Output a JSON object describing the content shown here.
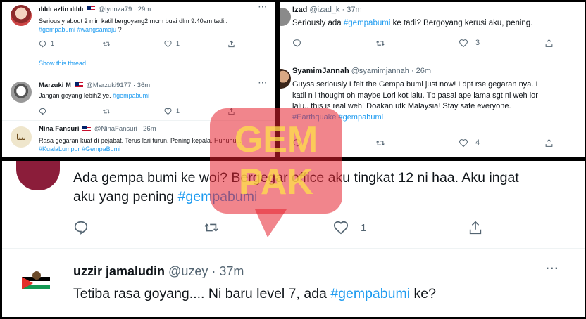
{
  "panel_top_left": {
    "tweets": [
      {
        "name": "ılılılı azlin ılılılı",
        "handle": "@lynnza79",
        "time": "29m",
        "text_plain": "Seriously about 2 min katil bergoyang2 mcm buai dlm 9.40am tadi..",
        "tags": [
          "#gempabumi",
          "#wangsamaju",
          "?"
        ],
        "reply_count": "1",
        "retweet_count": "",
        "like_count": "1",
        "show_thread": "Show this thread"
      },
      {
        "name": "Marzuki M",
        "handle": "@Marzuki9177",
        "time": "36m",
        "text_plain": "Jangan goyang lebih2 ye.",
        "tag": "#gempabumi",
        "reply_count": "",
        "retweet_count": "",
        "like_count": "1"
      },
      {
        "name": "Nina Fansuri",
        "handle": "@NinaFansuri",
        "time": "26m",
        "text_plain": "Rasa gegaran kuat di pejabat. Terus lari turun. Pening kepala. Huhuhu...",
        "tags": [
          "#KualaLumpur",
          "#GempaBumi"
        ]
      }
    ]
  },
  "panel_top_right": {
    "tweets": [
      {
        "name": "Izad",
        "handle": "@izad_k",
        "time": "37m",
        "text_before": "Seriously ada",
        "tag": "#gempabumi",
        "text_after": "ke tadi? Bergoyang kerusi aku, pening.",
        "reply_count": "",
        "retweet_count": "",
        "like_count": "3"
      },
      {
        "name": "SyamimJannah",
        "handle": "@syamimjannah",
        "time": "26m",
        "text_lines": [
          "Guyss seriously I felt the Gempa bumi just now! I dpt rse gegaran nya. I",
          "katil n i thought oh maybe Lori kot lalu. Tp pasal ape lama sgt ni weh lor",
          "lalu.. this is real weh! Doakan utk Malaysia! Stay safe everyone."
        ],
        "tags": [
          "#Earthquake",
          "#gempabumi"
        ],
        "reply_count": "",
        "retweet_count": "",
        "like_count": "4"
      }
    ]
  },
  "panel_bottom": {
    "tweets": [
      {
        "text_line1": "Ada gempa bumi ke woi? Bergegar office aku tingkat 12 ni haa. Aku ingat",
        "text_line2_plain": "aku yang pening",
        "tag": "#gempabumi",
        "reply_count": "",
        "retweet_count": "",
        "like_count": "1"
      },
      {
        "name": "uzzir jamaludin",
        "handle": "@uzey",
        "time": "37m",
        "text_before": "Tetiba rasa goyang.... Ni baru level 7, ada",
        "tag": "#gempabumi",
        "text_after": "ke?"
      }
    ]
  },
  "separator": "·",
  "more_label": "···",
  "watermark": {
    "text_top": "GEM",
    "text_bottom": "PAK",
    "color": "#e5202e"
  },
  "colors": {
    "accent": "#1d9bf0",
    "muted": "#536471",
    "text": "#0f1419"
  }
}
